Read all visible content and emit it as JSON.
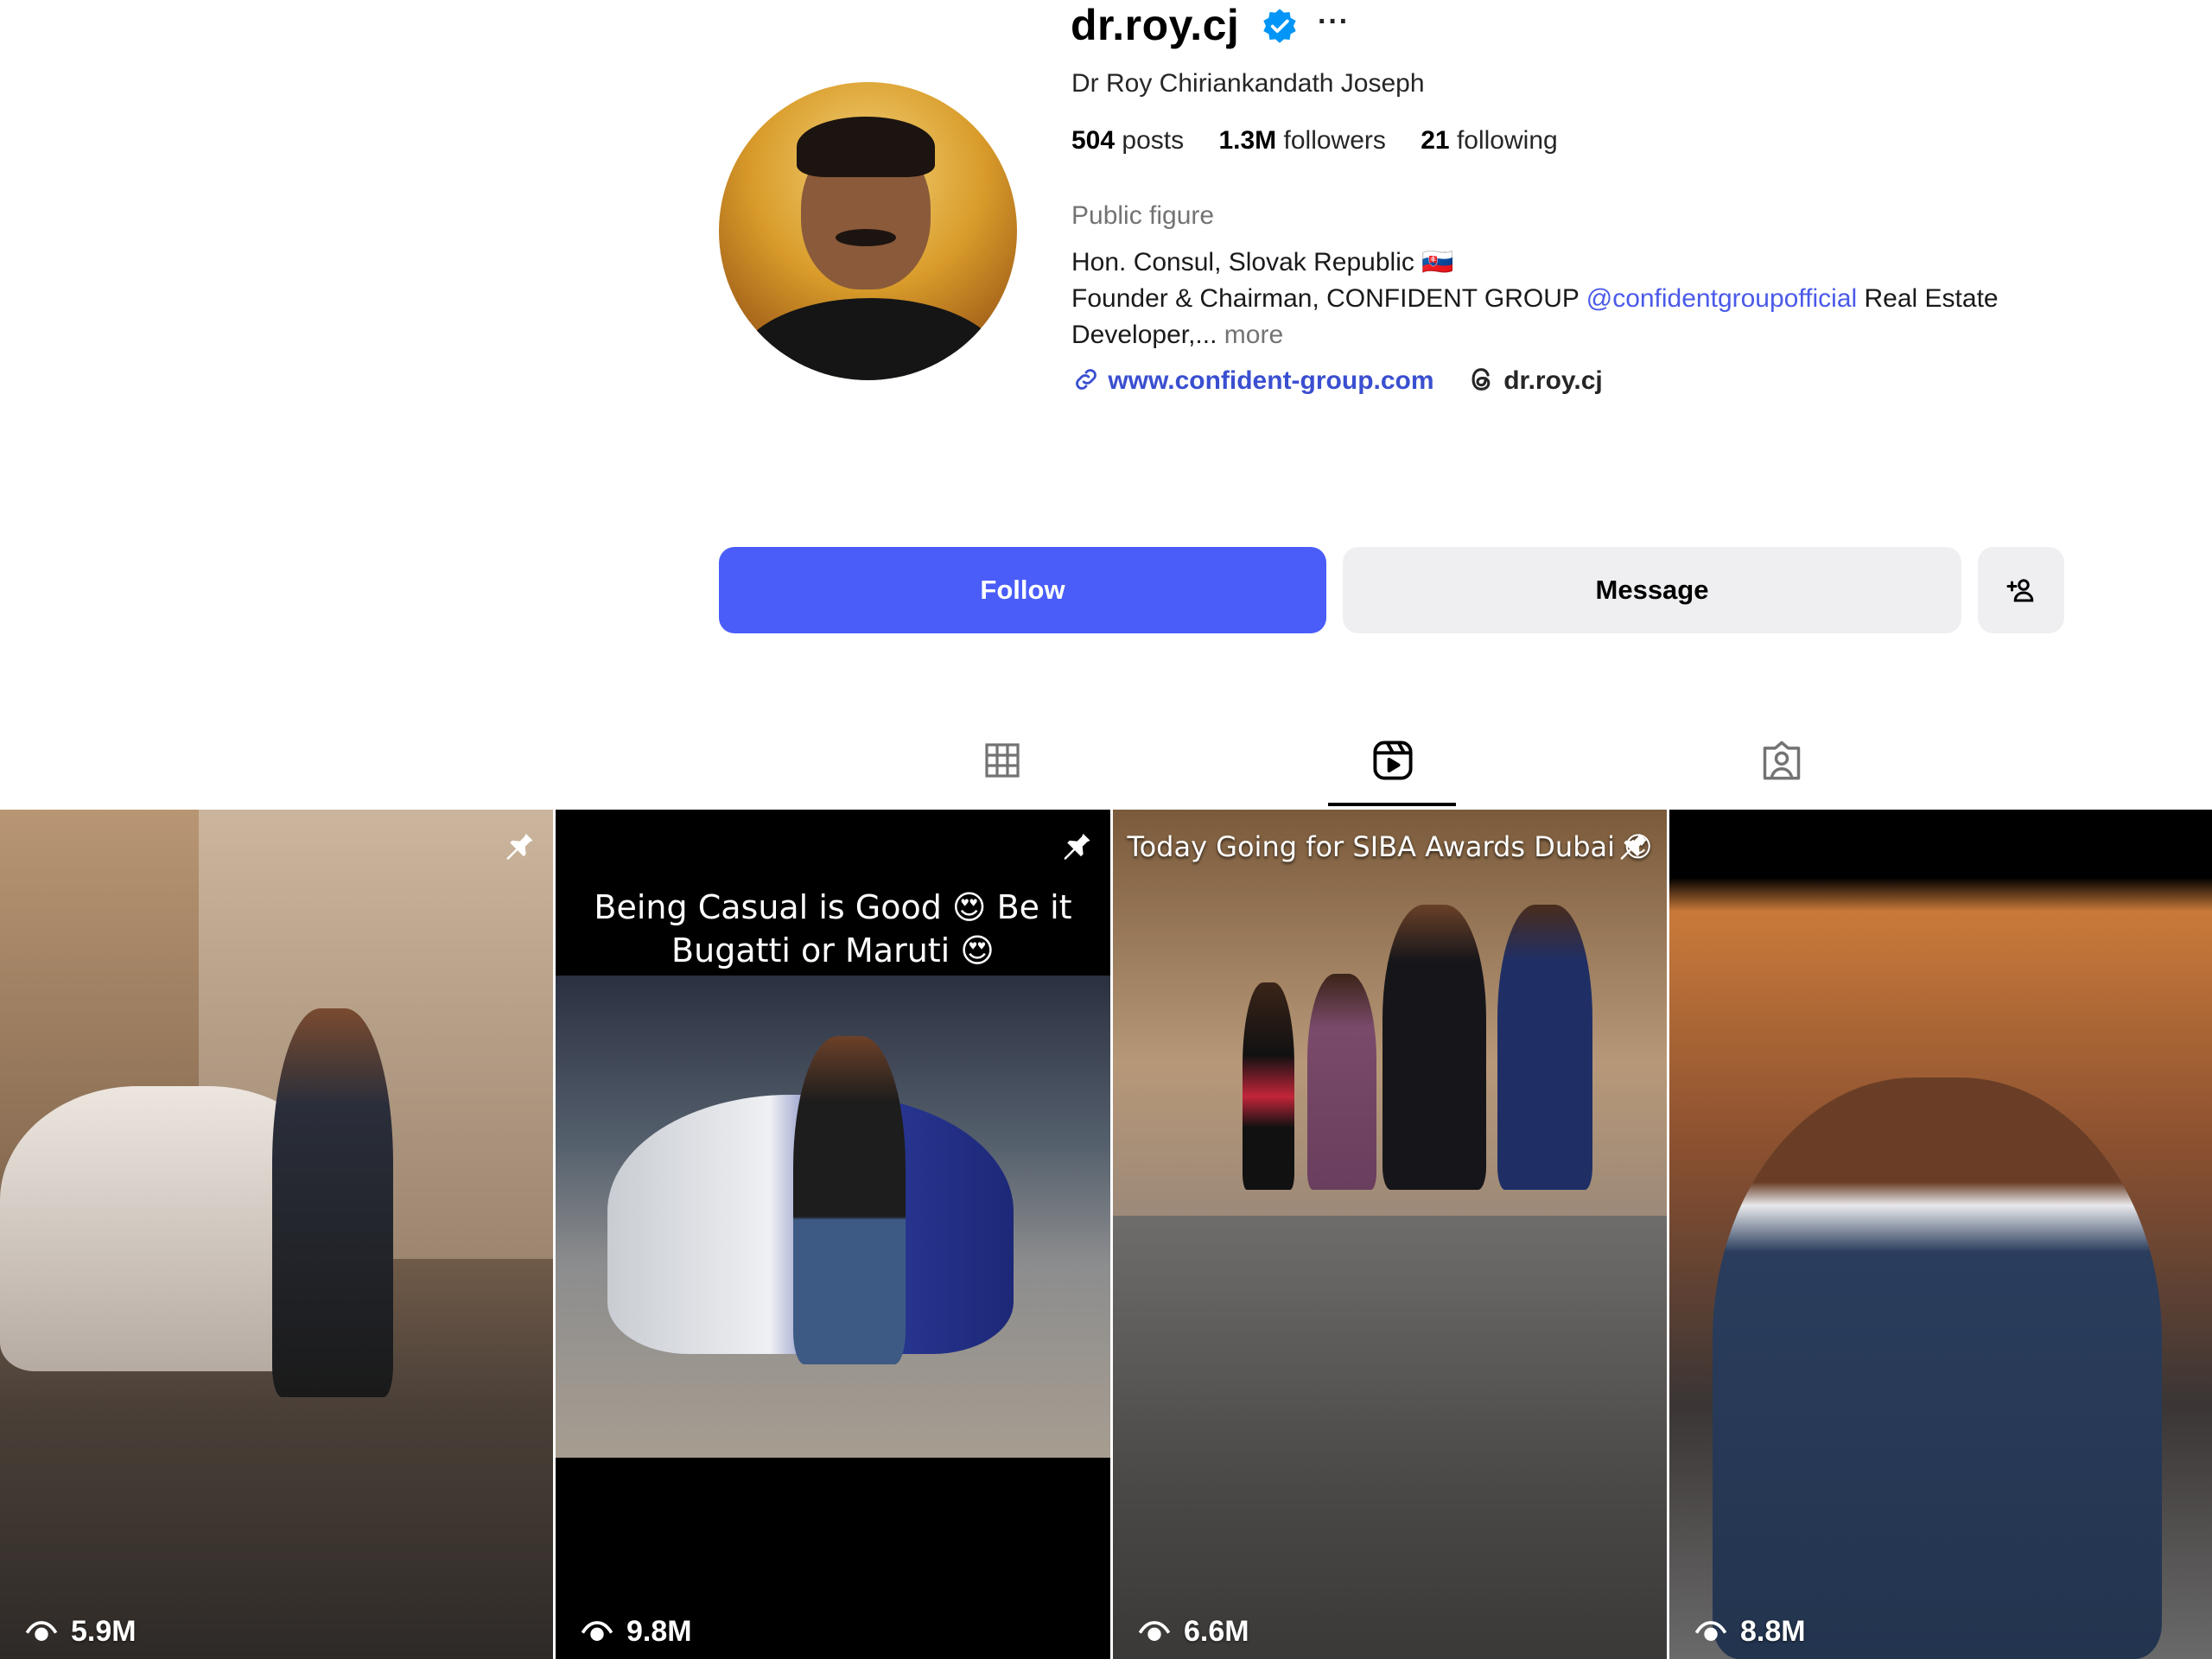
{
  "profile": {
    "username": "dr.roy.cj",
    "full_name": "Dr Roy Chiriankandath Joseph",
    "more_options": "···",
    "stats": {
      "posts_count": "504",
      "posts_label": "posts",
      "followers_count": "1.3M",
      "followers_label": "followers",
      "following_count": "21",
      "following_label": "following"
    },
    "category": "Public figure",
    "bio_line1": "Hon. Consul, Slovak Republic 🇸🇰",
    "bio_line2_prefix": "Founder & Chairman, CONFIDENT GROUP ",
    "bio_mention": "@confidentgroupofficial",
    "bio_line2_suffix": " Real Estate",
    "bio_line3": "Developer,...",
    "bio_more": "more",
    "website": "www.confident-group.com",
    "threads_handle": "dr.roy.cj"
  },
  "actions": {
    "follow_label": "Follow",
    "message_label": "Message"
  },
  "tabs": [
    {
      "name": "posts",
      "icon": "grid-icon"
    },
    {
      "name": "reels",
      "icon": "reels-icon",
      "active": true
    },
    {
      "name": "tagged",
      "icon": "tagged-icon"
    }
  ],
  "reels": [
    {
      "views": "5.9M",
      "pinned": true,
      "caption": ""
    },
    {
      "views": "9.8M",
      "pinned": true,
      "caption_line1": "Being Casual is Good 😍 Be it",
      "caption_line2": "Bugatti or Maruti 😍"
    },
    {
      "views": "6.6M",
      "pinned": true,
      "caption_line1": "Today Going for SIBA Awards Dubai 😍"
    },
    {
      "views": "8.8M",
      "pinned": false,
      "caption": ""
    }
  ],
  "colors": {
    "follow_button": "#4a5df9",
    "message_button": "#efeff2",
    "link": "#3a4fd0",
    "verified_badge": "#0095f6"
  }
}
